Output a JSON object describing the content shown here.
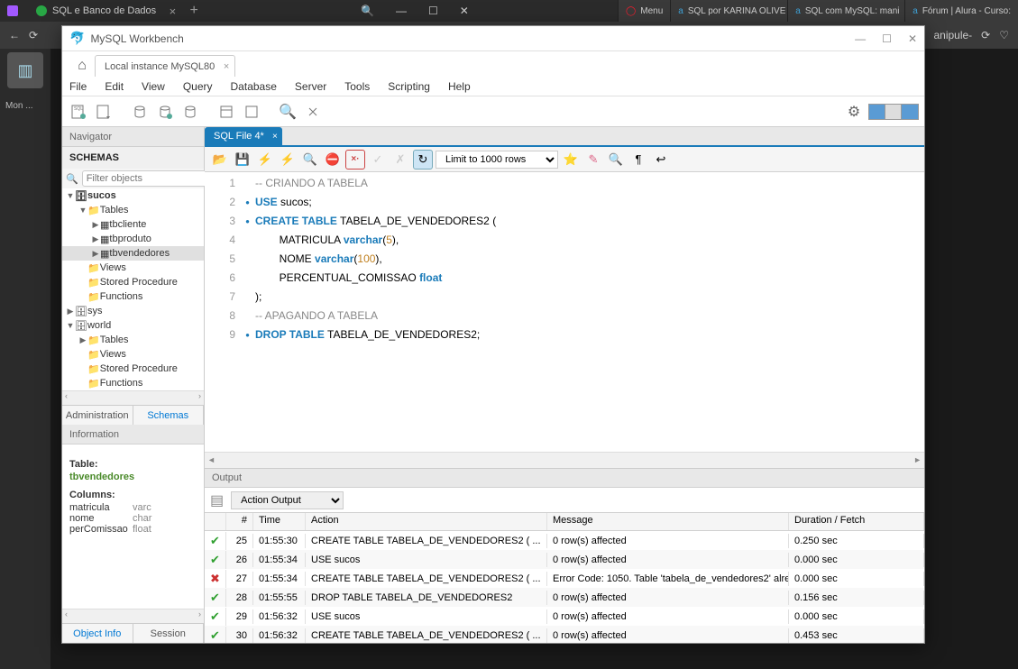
{
  "browser": {
    "tab_title": "SQL e Banco de Dados",
    "right_tabs": [
      "Menu",
      "SQL por KARINA OLIVE",
      "SQL com MySQL: mani",
      "Fórum | Alura - Curso:"
    ],
    "side_label": "Mon ...",
    "url_suffix": "anipule-"
  },
  "workbench": {
    "title": "MySQL Workbench",
    "conn_tab": "Local instance MySQL80",
    "menu": [
      "File",
      "Edit",
      "View",
      "Query",
      "Database",
      "Server",
      "Tools",
      "Scripting",
      "Help"
    ]
  },
  "navigator": {
    "label": "Navigator",
    "schemas_label": "SCHEMAS",
    "filter_placeholder": "Filter objects",
    "tree": {
      "sucos": "sucos",
      "tables_label": "Tables",
      "tbcliente": "tbcliente",
      "tbproduto": "tbproduto",
      "tbvendedores": "tbvendedores",
      "views_label": "Views",
      "sp_label": "Stored Procedure",
      "fn_label": "Functions",
      "sys": "sys",
      "world": "world"
    },
    "tabs": {
      "admin": "Administration",
      "schemas": "Schemas"
    }
  },
  "information": {
    "label": "Information",
    "table_label": "Table:",
    "table_name": "tbvendedores",
    "columns_label": "Columns:",
    "cols": [
      {
        "name": "matricula",
        "type": "varc"
      },
      {
        "name": "nome",
        "type": "char"
      },
      {
        "name": "perComissao",
        "type": "float"
      }
    ],
    "tabs": {
      "obj": "Object Info",
      "sess": "Session"
    }
  },
  "sql": {
    "tab": "SQL File 4*",
    "limit_label": "Limit to 1000 rows",
    "lines": [
      {
        "n": 1,
        "dot": false
      },
      {
        "n": 2,
        "dot": true
      },
      {
        "n": 3,
        "dot": true
      },
      {
        "n": 4,
        "dot": false
      },
      {
        "n": 5,
        "dot": false
      },
      {
        "n": 6,
        "dot": false
      },
      {
        "n": 7,
        "dot": false
      },
      {
        "n": 8,
        "dot": false
      },
      {
        "n": 9,
        "dot": true
      }
    ],
    "code": {
      "l1_comment": "-- CRIANDO A TABELA",
      "l2_use": "USE",
      "l2_db": "sucos",
      "l3_create": "CREATE TABLE",
      "l3_name": "TABELA_DE_VENDEDORES2 (",
      "l4_col": "MATRICULA",
      "l4_type": "varchar",
      "l4_sz": "5",
      "l5_col": "NOME",
      "l5_type": "varchar",
      "l5_sz": "100",
      "l6_col": "PERCENTUAL_COMISSAO",
      "l6_type": "float",
      "l7": ");",
      "l8_comment": "-- APAGANDO A TABELA",
      "l9_drop": "DROP TABLE",
      "l9_name": "TABELA_DE_VENDEDORES2;"
    }
  },
  "output": {
    "label": "Output",
    "selector": "Action Output",
    "headers": {
      "num": "#",
      "time": "Time",
      "action": "Action",
      "msg": "Message",
      "dur": "Duration / Fetch"
    },
    "rows": [
      {
        "status": "ok",
        "n": "25",
        "time": "01:55:30",
        "action": "CREATE TABLE TABELA_DE_VENDEDORES2 ( ...",
        "msg": "0 row(s) affected",
        "dur": "0.250 sec"
      },
      {
        "status": "ok",
        "n": "26",
        "time": "01:55:34",
        "action": "USE sucos",
        "msg": "0 row(s) affected",
        "dur": "0.000 sec"
      },
      {
        "status": "err",
        "n": "27",
        "time": "01:55:34",
        "action": "CREATE TABLE TABELA_DE_VENDEDORES2 ( ...",
        "msg": "Error Code: 1050. Table 'tabela_de_vendedores2' alre...",
        "dur": "0.000 sec"
      },
      {
        "status": "ok",
        "n": "28",
        "time": "01:55:55",
        "action": "DROP TABLE TABELA_DE_VENDEDORES2",
        "msg": "0 row(s) affected",
        "dur": "0.156 sec"
      },
      {
        "status": "ok",
        "n": "29",
        "time": "01:56:32",
        "action": "USE sucos",
        "msg": "0 row(s) affected",
        "dur": "0.000 sec"
      },
      {
        "status": "ok",
        "n": "30",
        "time": "01:56:32",
        "action": "CREATE TABLE TABELA_DE_VENDEDORES2 ( ...",
        "msg": "0 row(s) affected",
        "dur": "0.453 sec"
      }
    ]
  }
}
